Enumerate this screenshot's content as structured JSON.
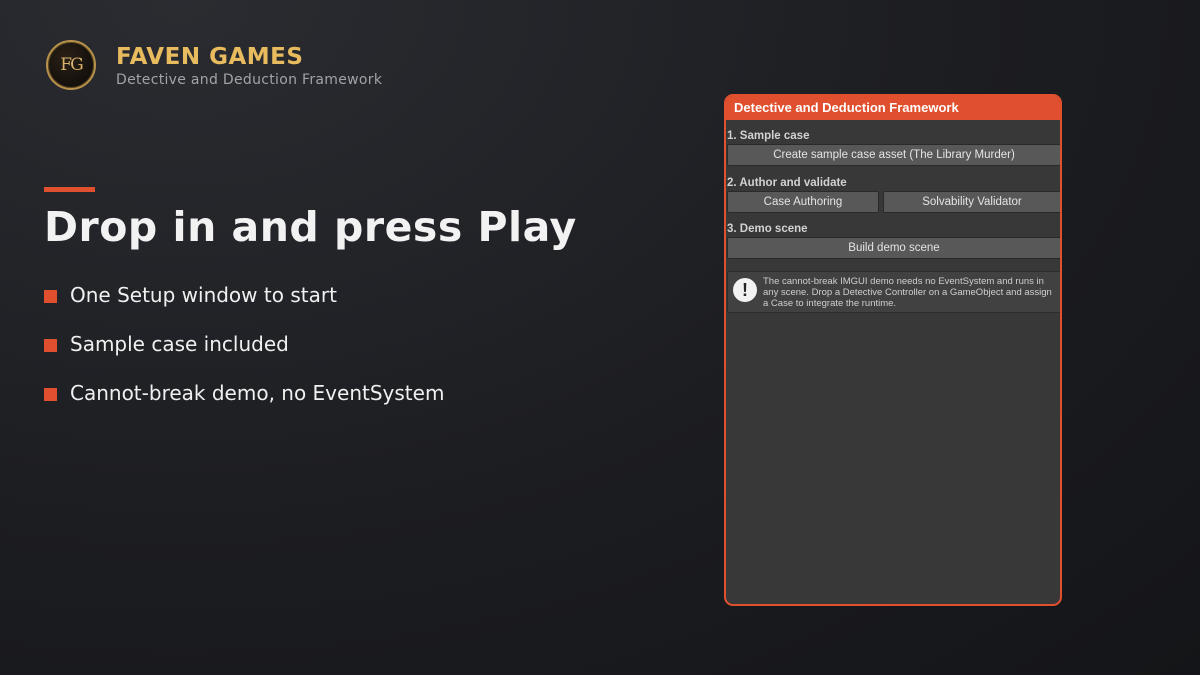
{
  "brand": {
    "logo_text": "FG",
    "name": "FAVEN GAMES",
    "subtitle": "Detective and Deduction Framework"
  },
  "slide": {
    "headline": "Drop in and press Play",
    "bullets": [
      "One Setup window to start",
      "Sample case included",
      "Cannot-break demo, no EventSystem"
    ]
  },
  "editor_window": {
    "title": "Detective and Deduction Framework",
    "sections": [
      {
        "label": "1. Sample case",
        "buttons": [
          "Create sample case asset (The Library Murder)"
        ]
      },
      {
        "label": "2. Author and validate",
        "buttons": [
          "Case Authoring",
          "Solvability Validator"
        ]
      },
      {
        "label": "3. Demo scene",
        "buttons": [
          "Build demo scene"
        ]
      }
    ],
    "help_icon": "warning-icon",
    "help_icon_glyph": "!",
    "help_text": "The cannot-break IMGUI demo needs no EventSystem and runs in any scene. Drop a Detective Controller on a GameObject and assign a Case to integrate the runtime."
  },
  "colors": {
    "accent": "#e0502f",
    "brand_gold": "#e8bb5e",
    "background": "#1c1d21",
    "panel": "#383838"
  }
}
